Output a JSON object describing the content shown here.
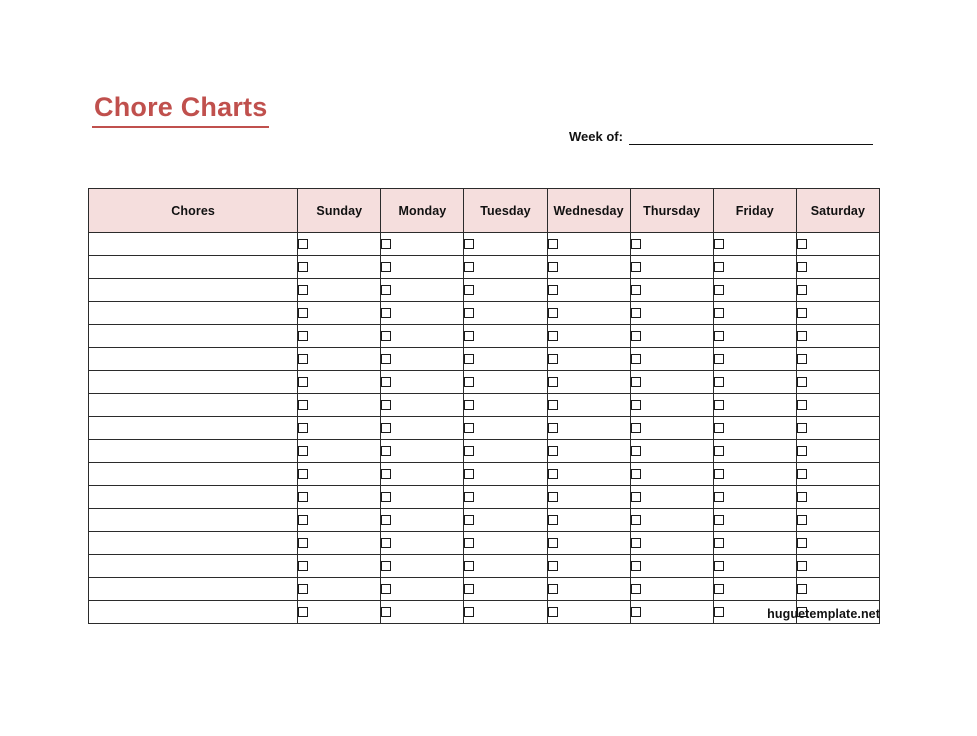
{
  "document": {
    "title": "Chore Charts",
    "title_color": "#c0504d",
    "watermark": "huguetemplate.net"
  },
  "week_of": {
    "label": "Week of:",
    "value": "",
    "placeholder": ""
  },
  "table": {
    "header_background": "#f5dedd",
    "border_color": "#2b2b2b",
    "columns": [
      "Chores",
      "Sunday",
      "Monday",
      "Tuesday",
      "Wednesday",
      "Thursday",
      "Friday",
      "Saturday"
    ],
    "row_count": 17,
    "day_column_count": 7,
    "checkbox_state": "unchecked",
    "rows": [
      {
        "chore": "",
        "checks": [
          false,
          false,
          false,
          false,
          false,
          false,
          false
        ]
      },
      {
        "chore": "",
        "checks": [
          false,
          false,
          false,
          false,
          false,
          false,
          false
        ]
      },
      {
        "chore": "",
        "checks": [
          false,
          false,
          false,
          false,
          false,
          false,
          false
        ]
      },
      {
        "chore": "",
        "checks": [
          false,
          false,
          false,
          false,
          false,
          false,
          false
        ]
      },
      {
        "chore": "",
        "checks": [
          false,
          false,
          false,
          false,
          false,
          false,
          false
        ]
      },
      {
        "chore": "",
        "checks": [
          false,
          false,
          false,
          false,
          false,
          false,
          false
        ]
      },
      {
        "chore": "",
        "checks": [
          false,
          false,
          false,
          false,
          false,
          false,
          false
        ]
      },
      {
        "chore": "",
        "checks": [
          false,
          false,
          false,
          false,
          false,
          false,
          false
        ]
      },
      {
        "chore": "",
        "checks": [
          false,
          false,
          false,
          false,
          false,
          false,
          false
        ]
      },
      {
        "chore": "",
        "checks": [
          false,
          false,
          false,
          false,
          false,
          false,
          false
        ]
      },
      {
        "chore": "",
        "checks": [
          false,
          false,
          false,
          false,
          false,
          false,
          false
        ]
      },
      {
        "chore": "",
        "checks": [
          false,
          false,
          false,
          false,
          false,
          false,
          false
        ]
      },
      {
        "chore": "",
        "checks": [
          false,
          false,
          false,
          false,
          false,
          false,
          false
        ]
      },
      {
        "chore": "",
        "checks": [
          false,
          false,
          false,
          false,
          false,
          false,
          false
        ]
      },
      {
        "chore": "",
        "checks": [
          false,
          false,
          false,
          false,
          false,
          false,
          false
        ]
      },
      {
        "chore": "",
        "checks": [
          false,
          false,
          false,
          false,
          false,
          false,
          false
        ]
      },
      {
        "chore": "",
        "checks": [
          false,
          false,
          false,
          false,
          false,
          false,
          false
        ]
      }
    ]
  }
}
